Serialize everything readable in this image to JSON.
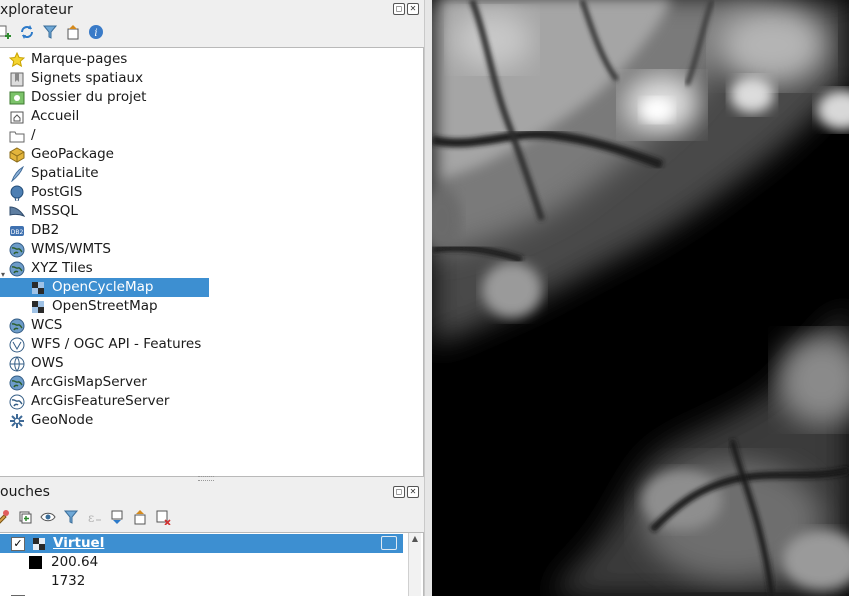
{
  "explorer": {
    "title": "xplorateur",
    "toolbar_icons": [
      "add-icon",
      "refresh-icon",
      "filter-icon",
      "collapse-all-icon",
      "info-icon"
    ],
    "items": [
      {
        "label": "Marque-pages",
        "icon": "star-icon"
      },
      {
        "label": "Signets spatiaux",
        "icon": "bookmark-icon"
      },
      {
        "label": "Dossier du projet",
        "icon": "project-folder-icon"
      },
      {
        "label": "Accueil",
        "icon": "home-icon"
      },
      {
        "label": "/",
        "icon": "folder-icon"
      },
      {
        "label": "GeoPackage",
        "icon": "geopackage-icon"
      },
      {
        "label": "SpatiaLite",
        "icon": "spatialite-icon"
      },
      {
        "label": "PostGIS",
        "icon": "postgis-icon"
      },
      {
        "label": "MSSQL",
        "icon": "mssql-icon"
      },
      {
        "label": "DB2",
        "icon": "db2-icon"
      },
      {
        "label": "WMS/WMTS",
        "icon": "globe-icon"
      },
      {
        "label": "XYZ Tiles",
        "icon": "globe-icon"
      },
      {
        "label": "OpenCycleMap",
        "icon": "tiles-icon"
      },
      {
        "label": "OpenStreetMap",
        "icon": "tiles-icon"
      },
      {
        "label": "WCS",
        "icon": "globe-icon"
      },
      {
        "label": "WFS / OGC API - Features",
        "icon": "globe-icon"
      },
      {
        "label": "OWS",
        "icon": "globe-icon"
      },
      {
        "label": "ArcGisMapServer",
        "icon": "globe-icon"
      },
      {
        "label": "ArcGisFeatureServer",
        "icon": "globe-icon"
      },
      {
        "label": "GeoNode",
        "icon": "geonode-icon"
      }
    ],
    "selected": "OpenCycleMap"
  },
  "layers": {
    "title": "ouches",
    "toolbar_icons": [
      "style-icon",
      "add-group-icon",
      "eye-icon",
      "filter-icon",
      "expression-icon",
      "expand-all-icon",
      "collapse-all-icon",
      "remove-layer-icon"
    ],
    "layer_name": "Virtuel",
    "legend_min": "200.64",
    "legend_max": "1732"
  },
  "colors": {
    "selection": "#3d8fd1",
    "panel_bg": "#efefef"
  }
}
